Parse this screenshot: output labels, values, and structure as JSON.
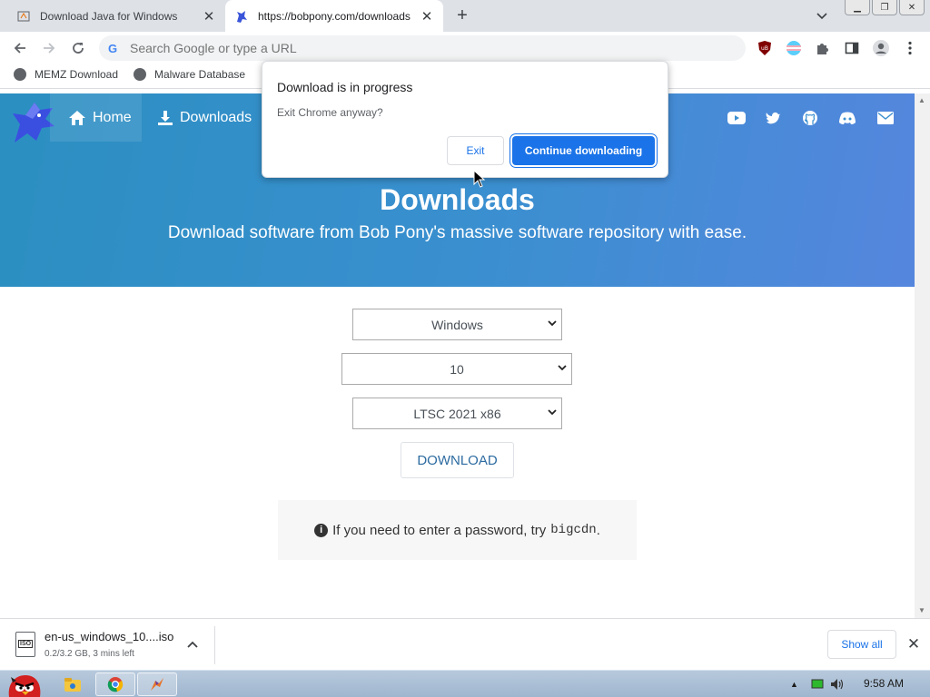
{
  "tabs": [
    {
      "title": "Download Java for Windows",
      "active": false
    },
    {
      "title": "https://bobpony.com/downloads",
      "active": true
    }
  ],
  "omnibox": {
    "placeholder": "Search Google or type a URL"
  },
  "bookmarks": [
    {
      "label": "MEMZ Download"
    },
    {
      "label": "Malware Database"
    }
  ],
  "site": {
    "nav": {
      "home": "Home",
      "downloads": "Downloads"
    },
    "hero_title": "Downloads",
    "hero_subtitle": "Download software from Bob Pony's massive software repository with ease.",
    "selects": {
      "os": "Windows",
      "version": "10",
      "edition": "LTSC 2021 x86"
    },
    "download_button": "DOWNLOAD",
    "note_text": "If you need to enter a password, try",
    "note_code": "bigcdn",
    "note_end": "."
  },
  "dialog": {
    "title": "Download is in progress",
    "message": "Exit Chrome anyway?",
    "exit": "Exit",
    "continue": "Continue downloading"
  },
  "download_shelf": {
    "filename": "en-us_windows_10....iso",
    "status": "0.2/3.2 GB, 3 mins left",
    "file_badge": "ISO",
    "show_all": "Show all"
  },
  "taskbar": {
    "time": "9:58 AM"
  },
  "colors": {
    "hero_start": "#2b8fc1",
    "hero_end": "#5586de",
    "accent": "#1a73e8"
  }
}
